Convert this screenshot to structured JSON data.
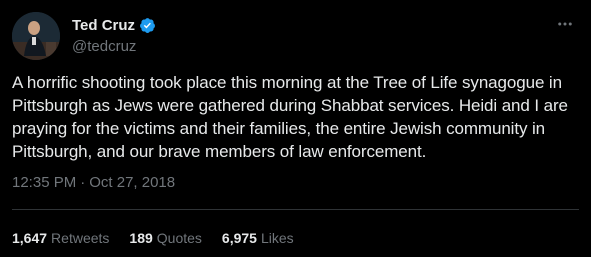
{
  "user": {
    "display_name": "Ted Cruz",
    "handle": "@tedcruz",
    "verified_icon": "verified-badge-icon",
    "avatar_icon": "avatar"
  },
  "tweet": {
    "text": "A horrific shooting took place this morning at the Tree of Life synagogue in Pittsburgh as Jews were gathered during Shabbat services. Heidi and I are praying for the victims and their families, the entire Jewish community in Pittsburgh, and our brave members of law enforcement.",
    "time": "12:35 PM",
    "separator": "·",
    "date": "Oct 27, 2018"
  },
  "stats": {
    "retweets_count": "1,647",
    "retweets_label": "Retweets",
    "quotes_count": "189",
    "quotes_label": "Quotes",
    "likes_count": "6,975",
    "likes_label": "Likes"
  },
  "colors": {
    "background": "#000000",
    "primary_text": "#e7e9ea",
    "secondary_text": "#71767b",
    "divider": "#2f3336",
    "verified": "#1d9bf0"
  },
  "icons": {
    "more": "more-horizontal-icon"
  }
}
